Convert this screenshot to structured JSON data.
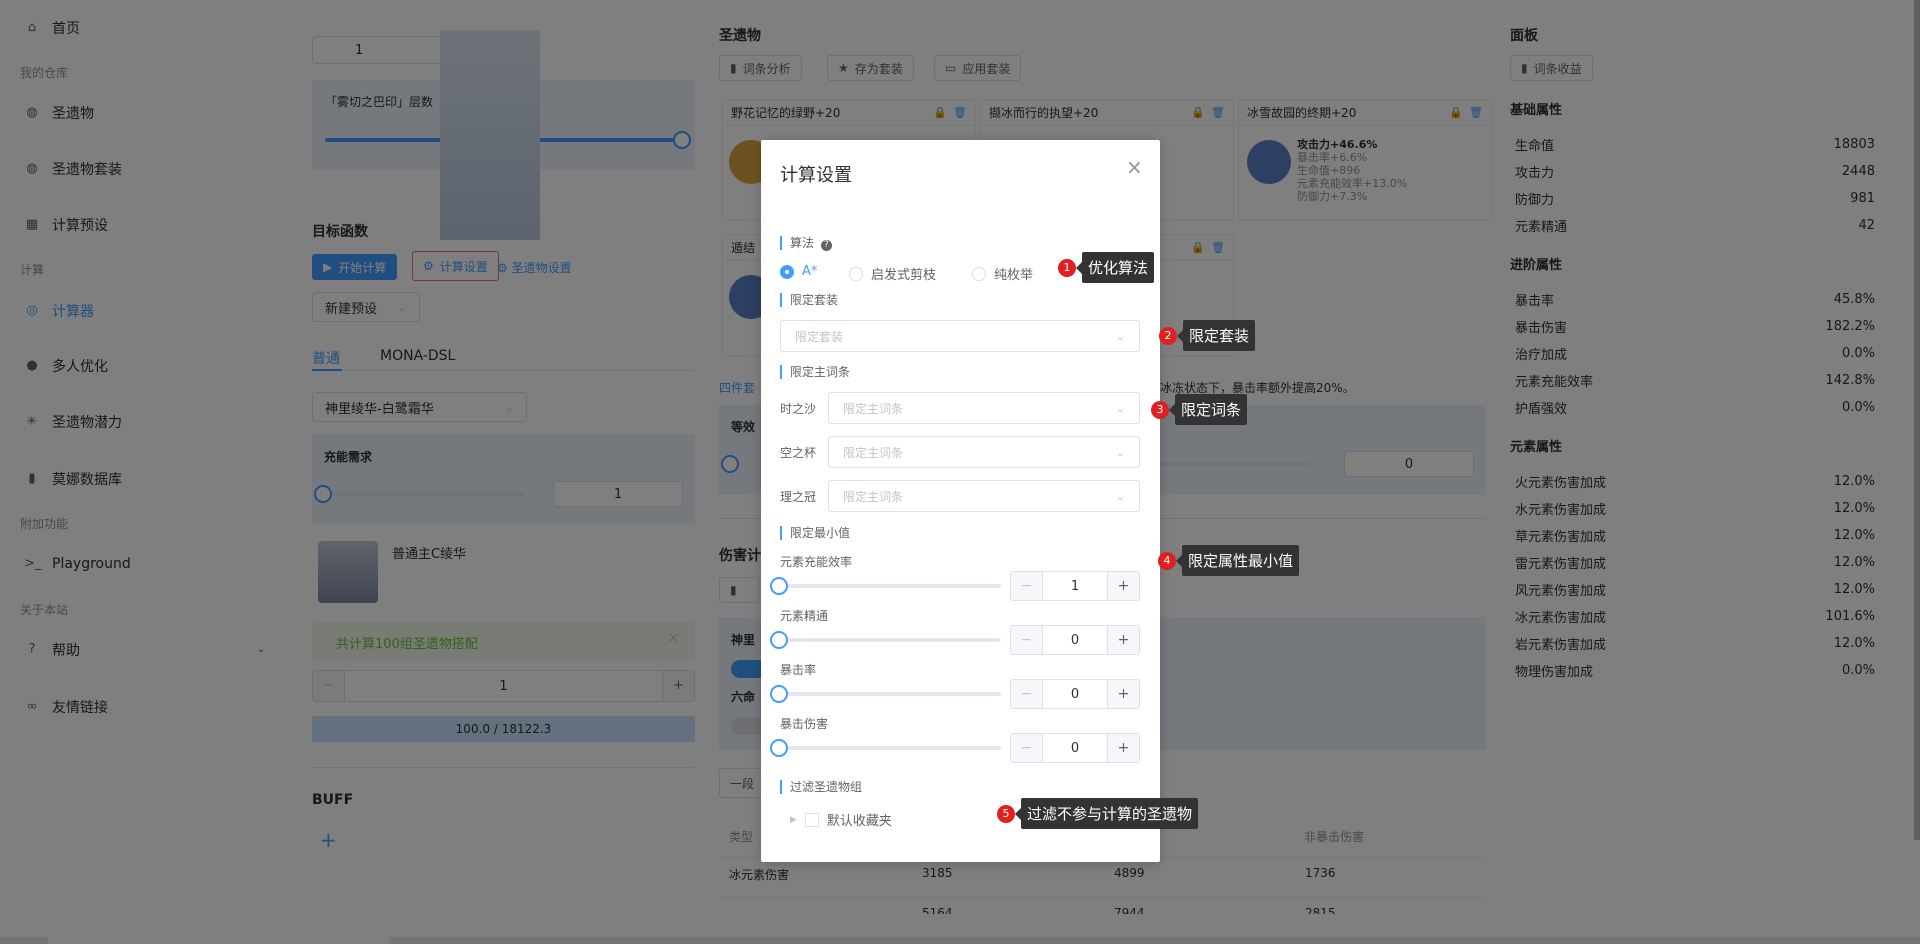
{
  "sidebar": {
    "items": [
      {
        "label": "首页",
        "icon": "home-icon"
      },
      {
        "label": "圣遗物",
        "icon": "artifact-icon"
      },
      {
        "label": "圣遗物套装",
        "icon": "artifact-set-icon"
      },
      {
        "label": "计算预设",
        "icon": "grid-icon"
      },
      {
        "label": "计算器",
        "icon": "calculator-icon"
      },
      {
        "label": "多人优化",
        "icon": "team-icon"
      },
      {
        "label": "圣遗物潜力",
        "icon": "sparkle-icon"
      },
      {
        "label": "莫娜数据库",
        "icon": "bar-chart-icon"
      },
      {
        "label": "Playground",
        "icon": "terminal-icon"
      },
      {
        "label": "帮助",
        "icon": "help-icon"
      },
      {
        "label": "友情链接",
        "icon": "link-icon"
      }
    ],
    "groups": [
      "我的仓库",
      "计算",
      "附加功能",
      "关于本站"
    ]
  },
  "left": {
    "level_value": "1",
    "seal_label": "「雾切之巴印」层数",
    "target_title": "目标函数",
    "start_btn": "开始计算",
    "calc_settings_btn": "计算设置",
    "artifact_settings_btn": "圣遗物设置",
    "preset_select": "新建预设",
    "tabs": [
      "普通",
      "MONA-DSL"
    ],
    "target_select": "神里绫华-白鹭霜华",
    "energy_label": "充能需求",
    "energy_value": "1",
    "char_name": "普通主C绫华",
    "alert_text": "共计算100组圣遗物搭配",
    "alert_close": "×",
    "page_value": "1",
    "page_minus": "−",
    "page_plus": "+",
    "progress_text": "100.0 / 18122.3",
    "buff_title": "BUFF",
    "buff_add": "+"
  },
  "middle": {
    "title": "圣遗物",
    "buttons": [
      "词条分析",
      "存为套装",
      "应用套装"
    ],
    "cards": [
      {
        "title": "野花记忆的绿野+20"
      },
      {
        "title": "撷冰而行的执望+20"
      },
      {
        "title": "冰雪故园的终期+20",
        "main": "攻击力+46.6%",
        "subs": [
          "暴击率+6.6%",
          "生命值+896",
          "元素充能效率+13.0%",
          "防御力+7.3%"
        ]
      }
    ],
    "card4_title": "遁结",
    "set_text_prefix": "四件套",
    "set_text_suffix": "冰冻状态下，暴击率额外提高20%。",
    "equiv_label": "等效",
    "input_zero": "0",
    "damage_title": "伤害计",
    "damage_sub": "神里",
    "six_label": "六命",
    "segment_label": "一段",
    "table": {
      "headers": [
        "类型",
        "",
        "",
        "非暴击伤害"
      ],
      "rows": [
        [
          "冰元素伤害",
          "3185",
          "4899",
          "1736"
        ],
        [
          "",
          "5164",
          "7944",
          "2815"
        ]
      ]
    }
  },
  "right": {
    "title": "面板",
    "btn": "词条收益",
    "basic_title": "基础属性",
    "basic": [
      [
        "生命值",
        "18803"
      ],
      [
        "攻击力",
        "2448"
      ],
      [
        "防御力",
        "981"
      ],
      [
        "元素精通",
        "42"
      ]
    ],
    "adv_title": "进阶属性",
    "adv": [
      [
        "暴击率",
        "45.8%"
      ],
      [
        "暴击伤害",
        "182.2%"
      ],
      [
        "治疗加成",
        "0.0%"
      ],
      [
        "元素充能效率",
        "142.8%"
      ],
      [
        "护盾强效",
        "0.0%"
      ]
    ],
    "elem_title": "元素属性",
    "elem": [
      [
        "火元素伤害加成",
        "12.0%"
      ],
      [
        "水元素伤害加成",
        "12.0%"
      ],
      [
        "草元素伤害加成",
        "12.0%"
      ],
      [
        "雷元素伤害加成",
        "12.0%"
      ],
      [
        "风元素伤害加成",
        "12.0%"
      ],
      [
        "冰元素伤害加成",
        "101.6%"
      ],
      [
        "岩元素伤害加成",
        "12.0%"
      ],
      [
        "物理伤害加成",
        "0.0%"
      ]
    ]
  },
  "modal": {
    "title": "计算设置",
    "close": "×",
    "algo_label": "算法",
    "algo_help": "?",
    "algo_options": [
      "A*",
      "启发式剪枝",
      "纯枚举"
    ],
    "algo_selected": "A*",
    "set_label": "限定套装",
    "set_placeholder": "限定套装",
    "main_label": "限定主词条",
    "slots": [
      {
        "name": "时之沙",
        "placeholder": "限定主词条"
      },
      {
        "name": "空之杯",
        "placeholder": "限定主词条"
      },
      {
        "name": "理之冠",
        "placeholder": "限定主词条"
      }
    ],
    "min_label": "限定最小值",
    "mins": [
      {
        "name": "元素充能效率",
        "value": "1"
      },
      {
        "name": "元素精通",
        "value": "0"
      },
      {
        "name": "暴击率",
        "value": "0"
      },
      {
        "name": "暴击伤害",
        "value": "0"
      }
    ],
    "minus": "−",
    "plus": "+",
    "filter_label": "过滤圣遗物组",
    "filter_item": "默认收藏夹"
  },
  "annotations": [
    {
      "num": "1",
      "text": "优化算法"
    },
    {
      "num": "2",
      "text": "限定套装"
    },
    {
      "num": "3",
      "text": "限定词条"
    },
    {
      "num": "4",
      "text": "限定属性最小值"
    },
    {
      "num": "5",
      "text": "过滤不参与计算的圣遗物"
    }
  ],
  "colors": {
    "accent": "#409eff",
    "annotation": "#e02020",
    "overlay": "rgba(0,0,0,0.5)"
  }
}
